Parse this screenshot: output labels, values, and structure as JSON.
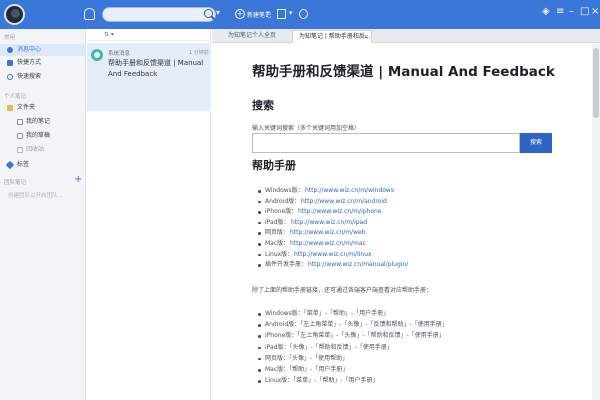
{
  "topbar": {
    "new_note": "新建笔记",
    "accent": "#3b77d8",
    "icons": [
      "avatar",
      "bell-icon",
      "search-icon",
      "plus-icon",
      "sync-icon",
      "share-icon",
      "window-controls"
    ]
  },
  "sidebar": {
    "section1": "常用",
    "items": [
      {
        "label": "消息中心",
        "icon": "message-icon"
      },
      {
        "label": "快捷方式",
        "icon": "shortcut-icon"
      },
      {
        "label": "快速搜索",
        "icon": "search-icon"
      }
    ],
    "section2": "个人笔记",
    "folder_root": "文件夹",
    "folders": [
      "我的笔记",
      "我的草稿",
      "回收站"
    ],
    "tags": "标签",
    "section3": "团队笔记",
    "team_hint": "创建团队以开启团队..."
  },
  "notelist": {
    "sort_label": "",
    "note": {
      "author": "系统消息",
      "time": "1 分钟前",
      "title": "帮助手册和反馈渠道 | Manual And Feedback"
    }
  },
  "tabs": [
    {
      "label": "为知笔记个人全页"
    },
    {
      "label": "为知笔记 | 帮助手册和反..."
    }
  ],
  "doc": {
    "title": "帮助手册和反馈渠道 | Manual And Feedback",
    "search_heading": "搜索",
    "search_hint": "输入关键词搜索（多个关键词用加空格）",
    "search_button": "搜索",
    "help_heading": "帮助手册",
    "links": [
      {
        "label": "Windows版：",
        "url": "http://www.wiz.cn/m/windows"
      },
      {
        "label": "Android版：",
        "url": "http://www.wiz.cn/m/android"
      },
      {
        "label": "iPhone版：",
        "url": "http://www.wiz.cn/m/iphone"
      },
      {
        "label": "iPad版：",
        "url": "http://www.wiz.cn/m/ipad"
      },
      {
        "label": "网页版：",
        "url": "http://www.wiz.cn/m/web"
      },
      {
        "label": "Mac版：",
        "url": "http://www.wiz.cn/m/mac"
      },
      {
        "label": "Linux版：",
        "url": "http://www.wiz.cn/m/linux"
      },
      {
        "label": "插件开发手册：",
        "url": "http://www.wiz.cn/manual/plugin/"
      }
    ],
    "paragraph": "除了上面的帮助手册链接，还可通过各端客户端查看对应帮助手册：",
    "paths": [
      "Windows版：「菜单」-「帮助」-「用户手册」",
      "Android版：「左上角菜单」-「头像」-「反馈和帮助」-「使用手册」",
      "iPhone版：「左上角菜单」-「头像」-「帮助和反馈」-「使用手册」",
      "iPad版：「头像」-「帮助和反馈」-「使用手册」",
      "网页版：「头像」-「使用帮助」",
      "Mac版：「帮助」-「用户手册」",
      "Linux版：「菜单」-「帮助」-「用户手册」"
    ]
  }
}
